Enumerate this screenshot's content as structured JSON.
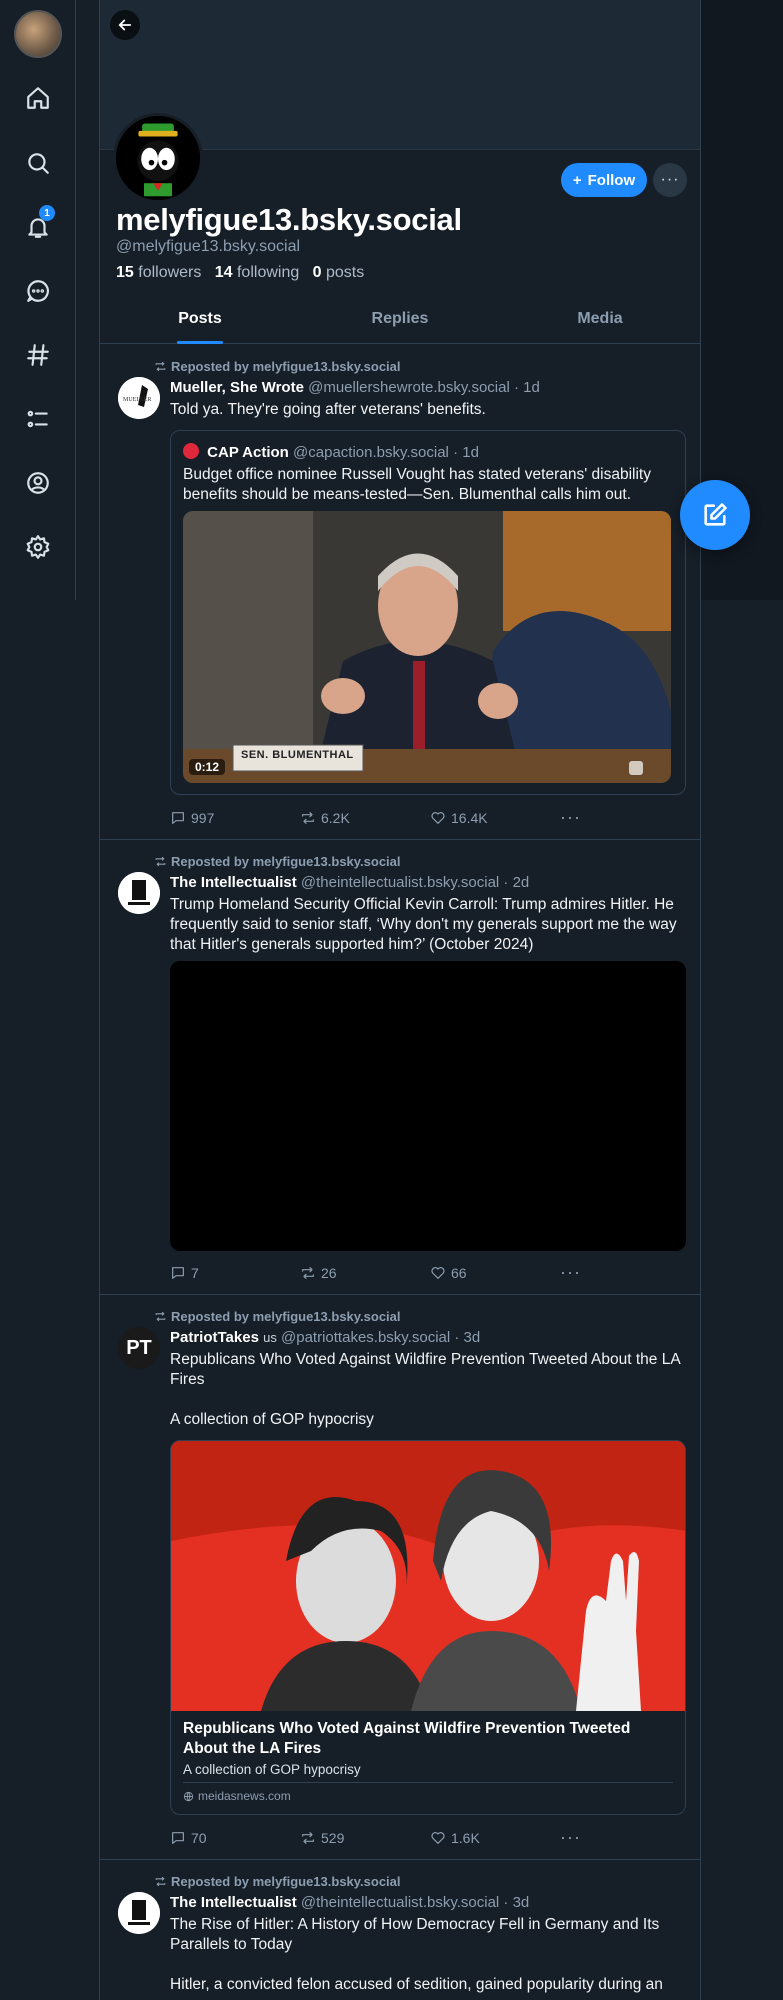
{
  "colors": {
    "accent": "#208bfe",
    "background": "#161e27",
    "muted": "#8d9eb0",
    "border": "#2e4052"
  },
  "nav": {
    "items": [
      {
        "icon": "home-icon"
      },
      {
        "icon": "search-icon"
      },
      {
        "icon": "bell-icon",
        "badge": "1"
      },
      {
        "icon": "chat-icon"
      },
      {
        "icon": "hashtag-icon"
      },
      {
        "icon": "list-icon"
      },
      {
        "icon": "profile-icon"
      },
      {
        "icon": "gear-icon"
      }
    ],
    "notification_badge": "1"
  },
  "profile": {
    "display_name": "melyfigue13.bsky.social",
    "handle": "@melyfigue13.bsky.social",
    "followers_count": "15",
    "followers_label": "followers",
    "following_count": "14",
    "following_label": "following",
    "posts_count": "0",
    "posts_label": "posts",
    "follow_label": "Follow",
    "more_label": "···"
  },
  "tabs": [
    {
      "label": "Posts",
      "active": true
    },
    {
      "label": "Replies",
      "active": false
    },
    {
      "label": "Media",
      "active": false
    }
  ],
  "posts": [
    {
      "repost_text": "Reposted by melyfigue13.bsky.social",
      "author": "Mueller, She Wrote",
      "handle": "@muellershewrote.bsky.social",
      "time": "· 1d",
      "text": "Told ya. They're going after veterans' benefits.",
      "quote": {
        "author": "CAP Action",
        "handle": "@capaction.bsky.social",
        "time": "· 1d",
        "text": "Budget office nominee Russell Vought has stated veterans' disability benefits should be means-tested—Sen. Blumenthal calls him out.",
        "video_duration": "0:12",
        "nameplate": "SEN. BLUMENTHAL"
      },
      "replies": "997",
      "reposts": "6.2K",
      "likes": "16.4K"
    },
    {
      "repost_text": "Reposted by melyfigue13.bsky.social",
      "author": "The Intellectualist",
      "handle": "@theintellectualist.bsky.social",
      "time": "· 2d",
      "text": "Trump Homeland Security Official Kevin Carroll: Trump admires Hitler. He frequently said to senior staff, ‘Why don't my generals support me the way that Hitler's generals supported him?’ (October 2024)",
      "replies": "7",
      "reposts": "26",
      "likes": "66"
    },
    {
      "repost_text": "Reposted by melyfigue13.bsky.social",
      "author": "PatriotTakes",
      "author_flag": "us",
      "handle": "@patriottakes.bsky.social",
      "time": "· 3d",
      "text_line1": "Republicans Who Voted Against Wildfire Prevention Tweeted About the LA Fires",
      "text_line2": "A collection of GOP hypocrisy",
      "avatar_text": "PT",
      "card": {
        "title": "Republicans Who Voted Against Wildfire Prevention Tweeted About the LA Fires",
        "description": "A collection of GOP hypocrisy",
        "domain": "meidasnews.com"
      },
      "replies": "70",
      "reposts": "529",
      "likes": "1.6K"
    },
    {
      "repost_text": "Reposted by melyfigue13.bsky.social",
      "author": "The Intellectualist",
      "handle": "@theintellectualist.bsky.social",
      "time": "· 3d",
      "text_line1": "The Rise of Hitler: A History of How Democracy Fell in Germany and Its Parallels to Today",
      "text_line2": "Hitler, a convicted felon accused of sedition, gained popularity during an"
    }
  ]
}
